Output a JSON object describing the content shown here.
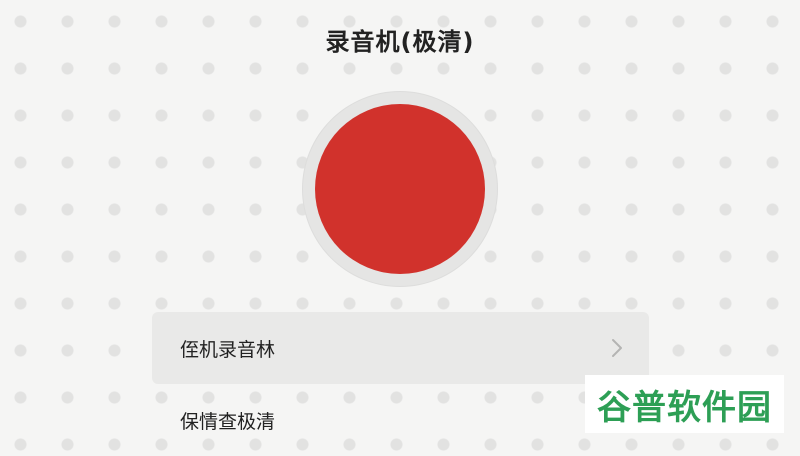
{
  "title": "录音机(极清)",
  "record_button": {
    "icon": "record-icon",
    "color": "#d1322c"
  },
  "menu": {
    "items": [
      {
        "label": "侄机录音林",
        "icon": "chevron-right-icon"
      },
      {
        "label": "保情查极清"
      }
    ]
  },
  "watermark": {
    "text": "谷普软件园",
    "color": "#2d9f55"
  }
}
